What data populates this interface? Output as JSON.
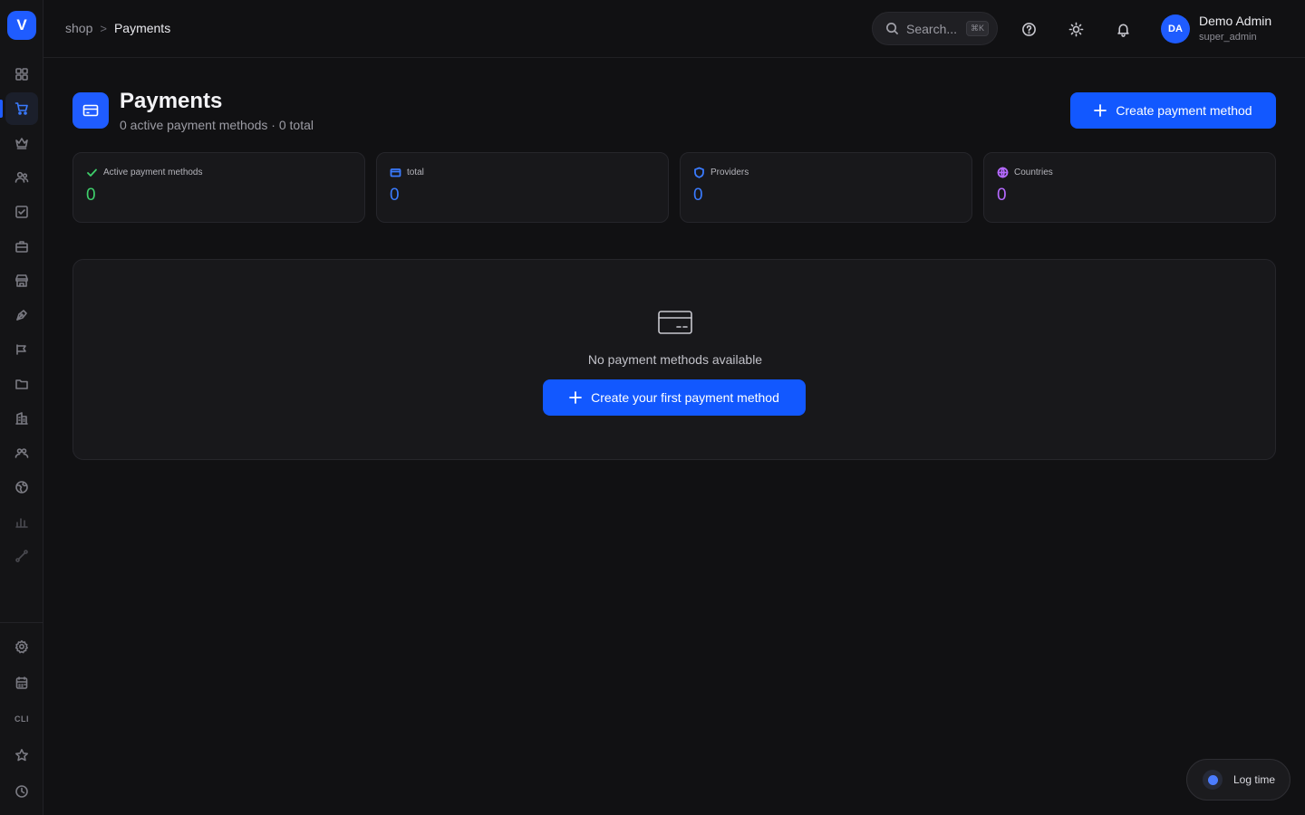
{
  "sidebar": {
    "logo": "V",
    "bottom_cli": "CLI",
    "icons": [
      "dashboard-icon",
      "shopping-cart-icon",
      "crown-icon",
      "users-icon",
      "checkbox-icon",
      "briefcase-icon",
      "store-icon",
      "pen-tool-icon",
      "megaphone-icon",
      "folder-icon",
      "building-icon",
      "team-icon",
      "globe-icon",
      "bar-chart-icon",
      "route-icon",
      "settings-icon",
      "calendar-icon",
      "star-icon",
      "clock-icon"
    ]
  },
  "header": {
    "breadcrumb": {
      "parent": "shop",
      "separator": ">",
      "current": "Payments"
    },
    "search": {
      "placeholder": "Search...",
      "shortcut": "⌘K"
    },
    "user": {
      "initials": "DA",
      "name": "Demo Admin",
      "role": "super_admin"
    }
  },
  "page": {
    "title": "Payments",
    "subtitle": "0 active payment methods · 0 total",
    "create_button": "Create payment method"
  },
  "stats": [
    {
      "label": "Active payment methods",
      "value": "0",
      "color": "#3ecf6b",
      "icon": "check-icon"
    },
    {
      "label": "total",
      "value": "0",
      "color": "#3a7bff",
      "icon": "credit-card-icon"
    },
    {
      "label": "Providers",
      "value": "0",
      "color": "#3a7bff",
      "icon": "shield-icon"
    },
    {
      "label": "Countries",
      "value": "0",
      "color": "#b569ff",
      "icon": "globe-icon"
    }
  ],
  "empty_state": {
    "message": "No payment methods available",
    "button": "Create your first payment method"
  },
  "log_time": {
    "label": "Log time"
  },
  "colors": {
    "accent": "#1258ff",
    "background": "#111113",
    "card": "#18181b"
  }
}
